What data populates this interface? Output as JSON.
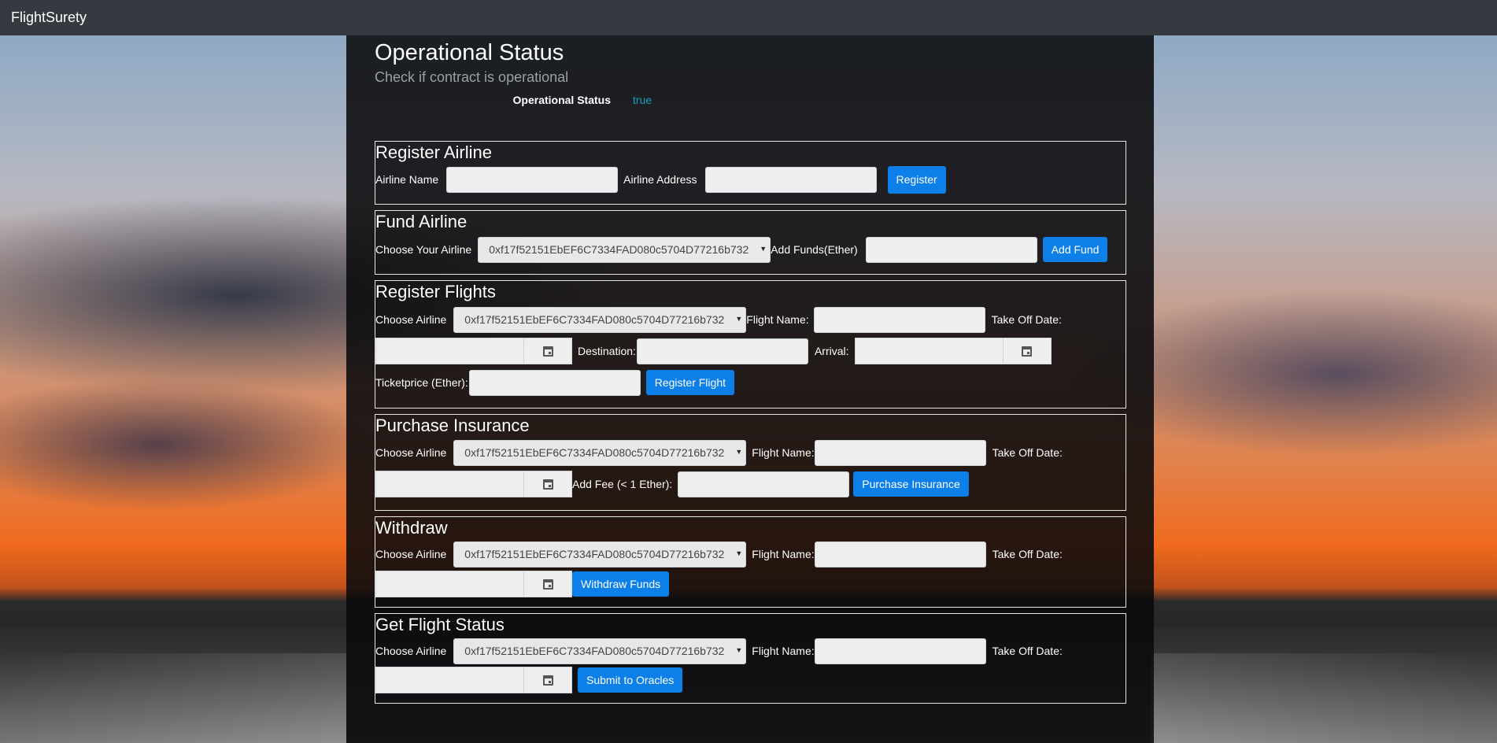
{
  "navbar": {
    "brand": "FlightSurety"
  },
  "operational": {
    "title": "Operational Status",
    "subtitle": "Check if contract is operational",
    "status_label": "Operational Status",
    "status_value": "true"
  },
  "register_airline": {
    "title": "Register Airline",
    "name_label": "Airline Name",
    "address_label": "Airline Address",
    "button": "Register"
  },
  "fund_airline": {
    "title": "Fund Airline",
    "choose_label": "Choose Your Airline",
    "airline_selected": "0xf17f52151EbEF6C7334FAD080c5704D77216b732",
    "funds_label": "Add Funds(Ether)",
    "button": "Add Fund"
  },
  "register_flights": {
    "title": "Register Flights",
    "choose_label": "Choose Airline",
    "airline_selected": "0xf17f52151EbEF6C7334FAD080c5704D77216b732",
    "flight_name_label": "Flight Name:",
    "takeoff_label": "Take Off Date:",
    "destination_label": "Destination:",
    "arrival_label": "Arrival:",
    "ticketprice_label": "Ticketprice (Ether):",
    "button": "Register Flight"
  },
  "purchase_insurance": {
    "title": "Purchase Insurance",
    "choose_label": "Choose Airline",
    "airline_selected": "0xf17f52151EbEF6C7334FAD080c5704D77216b732",
    "flight_name_label": "Flight Name:",
    "takeoff_label": "Take Off Date:",
    "fee_label": "Add Fee (< 1 Ether):",
    "button": "Purchase Insurance"
  },
  "withdraw": {
    "title": "Withdraw",
    "choose_label": "Choose Airline",
    "airline_selected": "0xf17f52151EbEF6C7334FAD080c5704D77216b732",
    "flight_name_label": "Flight Name:",
    "takeoff_label": "Take Off Date:",
    "button": "Withdraw Funds"
  },
  "flight_status": {
    "title": "Get Flight Status",
    "choose_label": "Choose Airline",
    "airline_selected": "0xf17f52151EbEF6C7334FAD080c5704D77216b732",
    "flight_name_label": "Flight Name:",
    "takeoff_label": "Take Off Date:",
    "button": "Submit to Oracles"
  },
  "icons": {
    "calendar": "calendar-icon",
    "dropdown": "chevron-down-icon"
  },
  "colors": {
    "navbar": "#343a40",
    "button": "#0d7fe8",
    "status_true": "#17a2b8"
  }
}
